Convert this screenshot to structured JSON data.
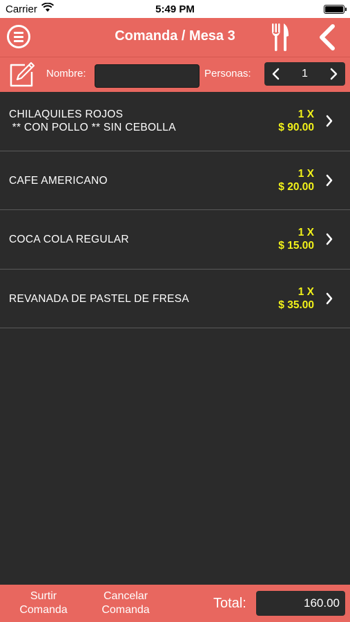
{
  "status_bar": {
    "carrier": "Carrier",
    "time": "5:49 PM"
  },
  "header": {
    "title": "Comanda / Mesa 3"
  },
  "order_info": {
    "name_label": "Nombre:",
    "name_value": "",
    "people_label": "Personas:",
    "people_count": "1"
  },
  "items": [
    {
      "name_line1": "CHILAQUILES ROJOS",
      "name_line2": " ** CON POLLO ** SIN CEBOLLA",
      "qty": "1 X",
      "price": "$ 90.00"
    },
    {
      "name_line1": "CAFE AMERICANO",
      "name_line2": "",
      "qty": "1 X",
      "price": "$ 20.00"
    },
    {
      "name_line1": "COCA COLA REGULAR",
      "name_line2": "",
      "qty": "1 X",
      "price": "$ 15.00"
    },
    {
      "name_line1": "REVANADA DE PASTEL DE FRESA",
      "name_line2": "",
      "qty": "1 X",
      "price": "$ 35.00"
    }
  ],
  "footer": {
    "surtir_line1": "Surtir",
    "surtir_line2": "Comanda",
    "cancelar_line1": "Cancelar",
    "cancelar_line2": "Comanda",
    "total_label": "Total:",
    "total_value": "160.00"
  },
  "colors": {
    "accent": "#e8675f",
    "background": "#2b2b2b",
    "price": "#f2f21a"
  }
}
